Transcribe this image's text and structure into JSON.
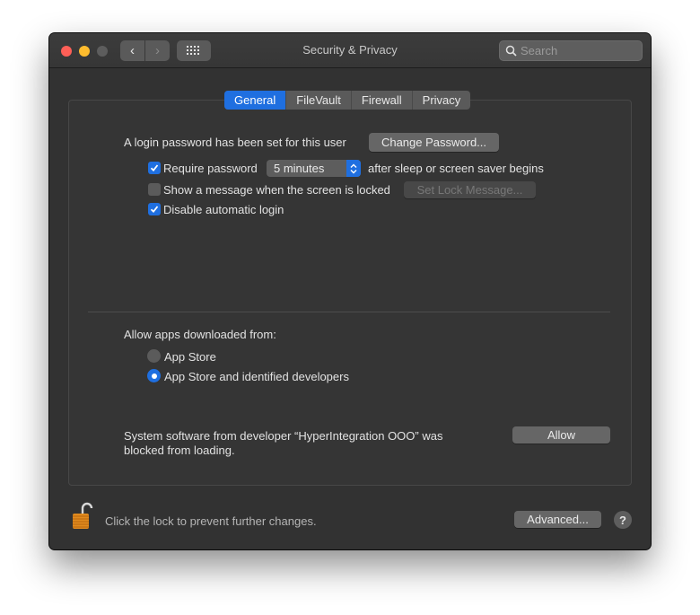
{
  "window": {
    "title": "Security & Privacy",
    "search_placeholder": "Search"
  },
  "tabs": [
    {
      "label": "General",
      "active": true
    },
    {
      "label": "FileVault",
      "active": false
    },
    {
      "label": "Firewall",
      "active": false
    },
    {
      "label": "Privacy",
      "active": false
    }
  ],
  "general": {
    "login_password_text": "A login password has been set for this user",
    "change_password_label": "Change Password...",
    "require_password": {
      "label": "Require password",
      "checked": true
    },
    "require_password_delay": "5 minutes",
    "after_sleep_text": "after sleep or screen saver begins",
    "show_message": {
      "label": "Show a message when the screen is locked",
      "checked": false
    },
    "set_lock_message_label": "Set Lock Message...",
    "disable_auto_login": {
      "label": "Disable automatic login",
      "checked": true
    }
  },
  "allow_apps": {
    "heading": "Allow apps downloaded from:",
    "options": [
      {
        "label": "App Store",
        "selected": false
      },
      {
        "label": "App Store and identified developers",
        "selected": true
      }
    ]
  },
  "blocked": {
    "line1": "System software from developer “HyperIntegration OOO” was",
    "line2": "blocked from loading.",
    "allow_label": "Allow"
  },
  "footer": {
    "lock_text": "Click the lock to prevent further changes.",
    "advanced_label": "Advanced...",
    "help_label": "?"
  },
  "colors": {
    "accent": "#1f6fe0",
    "window_bg": "#323232",
    "close": "#fe5f57",
    "minimize": "#febc2e"
  }
}
